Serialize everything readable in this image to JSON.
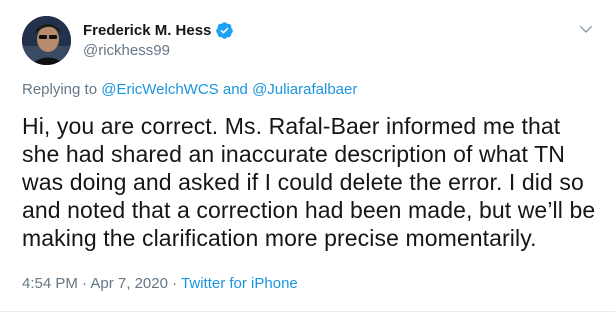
{
  "author": {
    "display_name": "Frederick M. Hess",
    "handle": "@rickhess99",
    "avatar_icon": "profile-photo",
    "verified_icon": "verified-badge-icon"
  },
  "reply": {
    "prefix": "Replying to",
    "user1": "@EricWelchWCS",
    "conjunction": "and",
    "user2": "@Juliarafalbaer"
  },
  "tweet": {
    "text": "Hi, you are correct. Ms. Rafal-Baer informed me that she had shared an inaccurate description of what TN was doing and asked if I could delete the error. I did so and noted that a correction had been made, but we’ll be making the clarification more precise momentarily."
  },
  "meta": {
    "time": "4:54 PM",
    "separator": "·",
    "date": "Apr 7, 2020",
    "source": "Twitter for iPhone"
  },
  "colors": {
    "accent": "#1b95e0",
    "secondary_text": "#657786",
    "primary_text": "#14171a"
  }
}
